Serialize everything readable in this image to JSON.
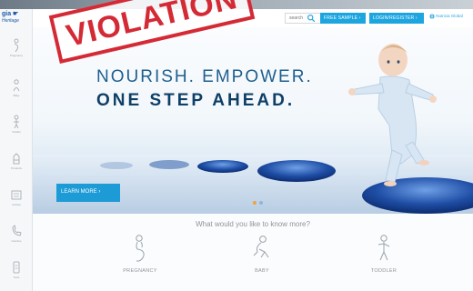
{
  "logo": {
    "line1": "gia ☛",
    "line2": "Heritage"
  },
  "sidebar": {
    "items": [
      {
        "icon": "pregnancy-icon",
        "caption": "Pregnancy"
      },
      {
        "icon": "baby-icon",
        "caption": "Baby"
      },
      {
        "icon": "toddler-icon",
        "caption": "Toddler"
      },
      {
        "icon": "products-icon",
        "caption": "Products"
      },
      {
        "icon": "articles-icon",
        "caption": "Articles"
      },
      {
        "icon": "careline-icon",
        "caption": "Careline"
      },
      {
        "icon": "tools-icon",
        "caption": "Tools"
      }
    ]
  },
  "header": {
    "search_placeholder": "search",
    "free_sample": "FREE SAMPLE  ›",
    "login_register": "LOGIN/REGISTER  ›",
    "nutricia": "Nutricia Global"
  },
  "hero": {
    "headline_line1": "NOURISH. EMPOWER.",
    "headline_line2": "ONE STEP AHEAD.",
    "cta": "LEARN MORE  ›",
    "carousel_active_index": 0,
    "carousel_count": 2
  },
  "question": "What would you like to know more?",
  "categories": [
    {
      "label": "PREGNANCY",
      "icon": "pregnancy-icon"
    },
    {
      "label": "BABY",
      "icon": "baby-icon"
    },
    {
      "label": "TODDLER",
      "icon": "toddler-icon"
    }
  ],
  "stamp": {
    "text": "VIOLATION"
  },
  "colors": {
    "accent": "#1da5df",
    "headline": "#0f3f66",
    "stamp": "#d42a35"
  }
}
